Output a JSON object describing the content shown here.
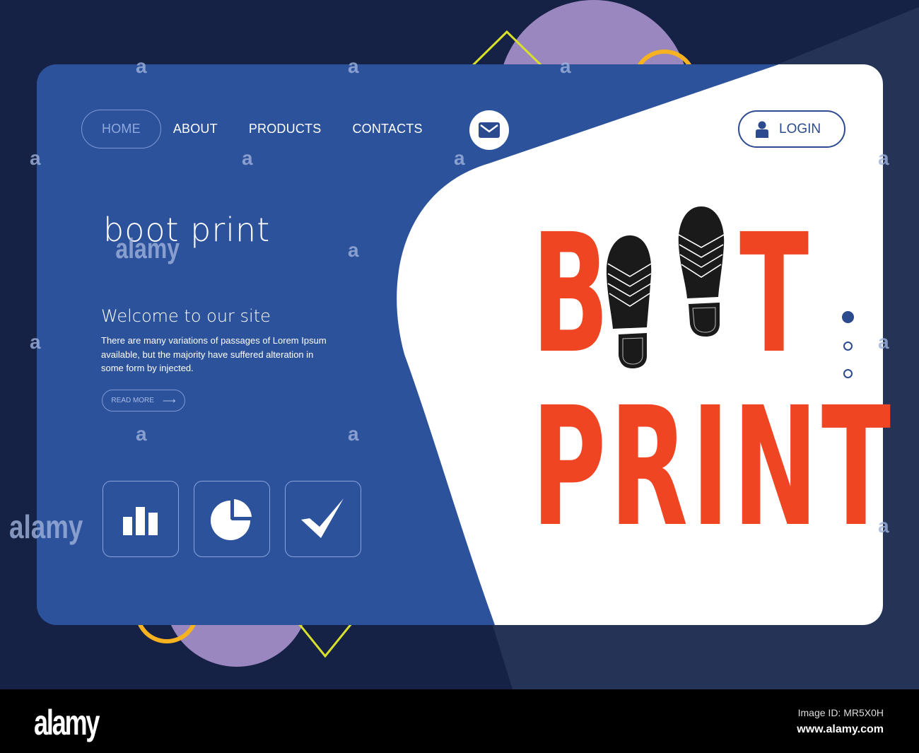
{
  "nav": {
    "items": [
      {
        "label": "HOME",
        "active": true
      },
      {
        "label": "ABOUT",
        "active": false
      },
      {
        "label": "PRODUCTS",
        "active": false
      },
      {
        "label": "CONTACTS",
        "active": false
      }
    ],
    "mail_icon": "envelope-icon",
    "login_label": "LOGIN",
    "login_icon": "user-icon"
  },
  "hero": {
    "site_title": "boot print",
    "welcome": "Welcome to our site",
    "description": "There are many variations of passages of Lorem Ipsum available, but the majority have suffered alteration in some form by injected.",
    "read_more_label": "READ MORE",
    "read_more_icon": "arrow-right-icon",
    "read_more_arrow": "⟶"
  },
  "features": [
    {
      "icon": "bar-chart-icon"
    },
    {
      "icon": "pie-chart-icon"
    },
    {
      "icon": "checkmark-icon"
    }
  ],
  "illustration": {
    "line1_start": "B",
    "line1_end": "T",
    "line2": "PRINT",
    "footprint_icon": "boot-sole-icon"
  },
  "carousel": {
    "total": 3,
    "active_index": 0
  },
  "colors": {
    "background": "#152145",
    "card_blue": "#2c529c",
    "accent_red": "#f04523",
    "login_blue": "#2c4a8e",
    "lavender": "#9a87bf",
    "yellow_line": "#d9e02a",
    "orange_ring": "#f7b21f"
  },
  "footer": {
    "brand": "alamy",
    "image_id": "Image ID: MR5X0H",
    "website": "www.alamy.com"
  },
  "watermark": {
    "glyph": "a",
    "word": "alamy"
  }
}
